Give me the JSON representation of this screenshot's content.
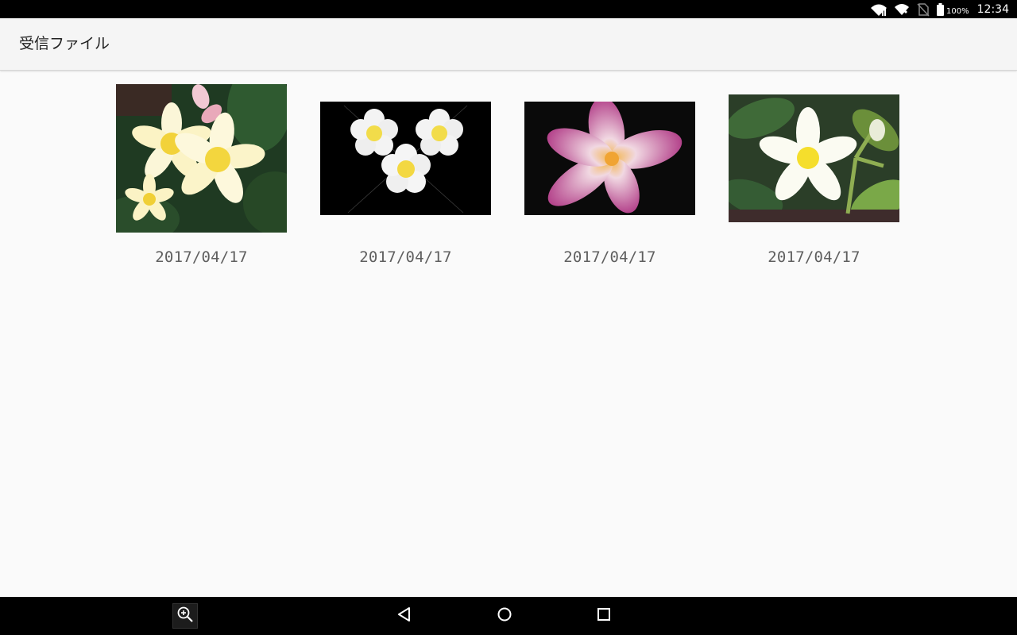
{
  "status_bar": {
    "battery_percent": "100%",
    "time": "12:34",
    "icons": [
      "signal-icon",
      "wifi-icon",
      "no-sim-icon",
      "battery-icon"
    ]
  },
  "app_bar": {
    "title": "受信ファイル"
  },
  "files": [
    {
      "date": "2017/04/17",
      "thumbnail": "yellow-plumeria-cluster"
    },
    {
      "date": "2017/04/17",
      "thumbnail": "white-plumeria-trio-on-black"
    },
    {
      "date": "2017/04/17",
      "thumbnail": "pink-plumeria-on-black"
    },
    {
      "date": "2017/04/17",
      "thumbnail": "white-yellow-plumeria-with-leaves"
    }
  ],
  "nav_bar": {
    "icons": [
      "zoom-in-icon",
      "back-icon",
      "home-icon",
      "recents-icon"
    ]
  },
  "colors": {
    "status_bar": "#000000",
    "app_bar": "#f5f5f5",
    "background": "#fafafa",
    "nav_bar": "#000000",
    "date_text": "#5f5f5f"
  }
}
